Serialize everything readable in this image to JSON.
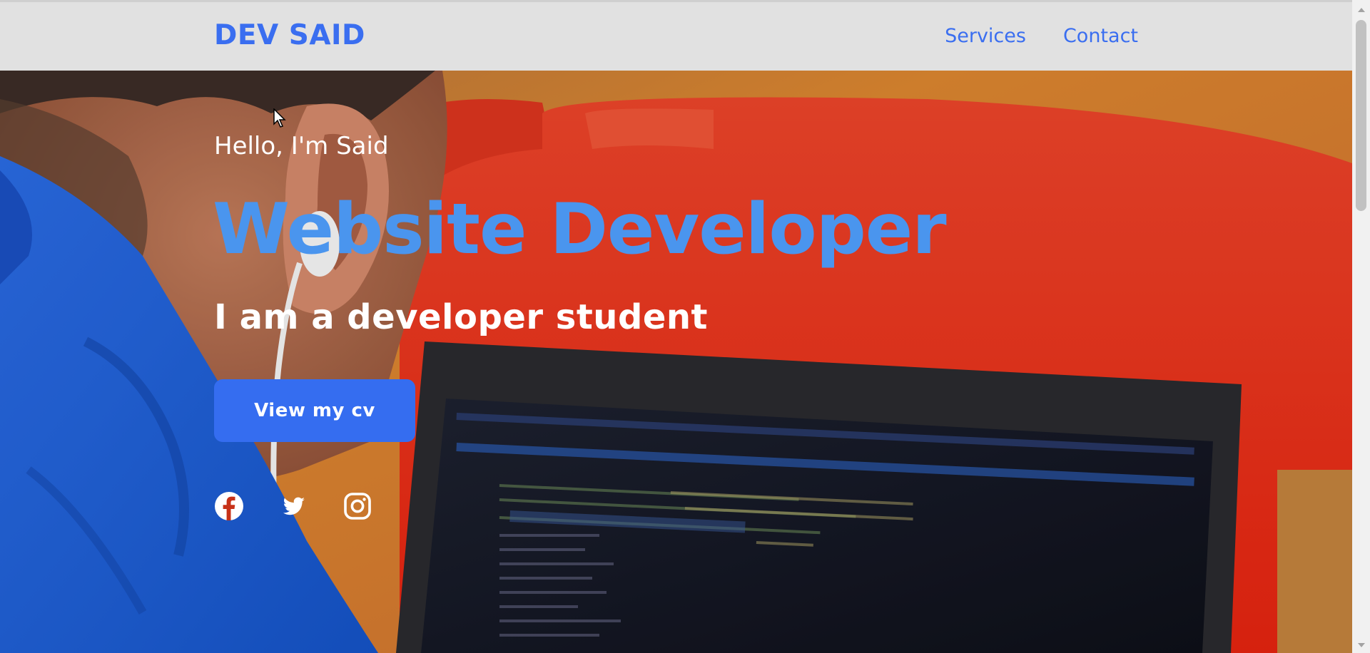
{
  "header": {
    "logo": "DEV SAID",
    "nav": [
      "Services",
      "Contact"
    ]
  },
  "hero": {
    "greeting": "Hello, I'm Said",
    "title": "Website Developer",
    "subtitle": "I am a developer student",
    "cta_label": "View my cv",
    "socials": [
      "facebook-icon",
      "twitter-icon",
      "instagram-icon"
    ]
  },
  "colors": {
    "brand": "#3a6ef0",
    "header_bg": "#e1e1e1",
    "title": "#4a95ee",
    "button": "#356df0"
  }
}
